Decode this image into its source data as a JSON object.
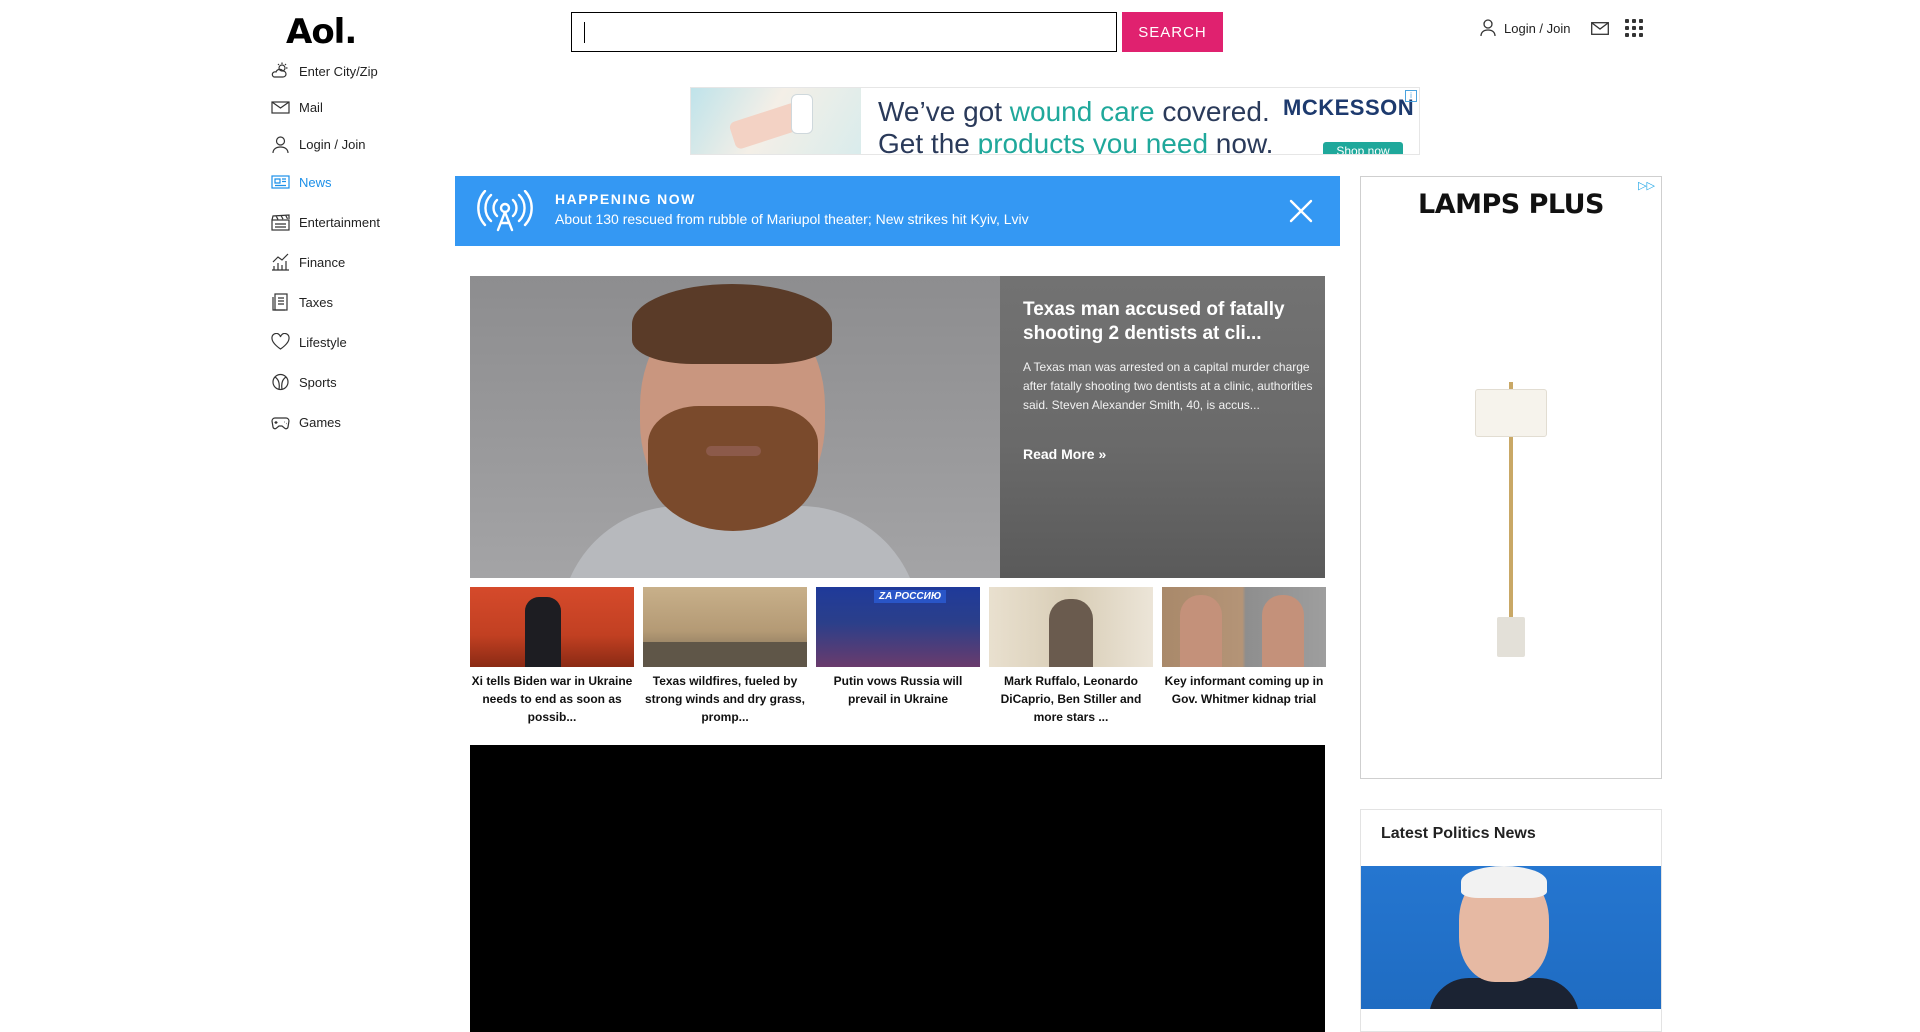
{
  "header": {
    "logo": "Aol.",
    "search": {
      "value": "",
      "button": "SEARCH"
    },
    "login": "Login / Join",
    "mail_icon": "mail-icon",
    "apps_icon": "apps-grid-icon"
  },
  "sidebar": {
    "items": [
      {
        "label": "Enter City/Zip",
        "icon": "weather-icon",
        "active": false
      },
      {
        "label": "Mail",
        "icon": "mail-icon",
        "active": false
      },
      {
        "label": "Login / Join",
        "icon": "user-icon",
        "active": false
      },
      {
        "label": "News",
        "icon": "news-icon",
        "active": true
      },
      {
        "label": "Entertainment",
        "icon": "clapperboard-icon",
        "active": false
      },
      {
        "label": "Finance",
        "icon": "finance-chart-icon",
        "active": false
      },
      {
        "label": "Taxes",
        "icon": "taxes-icon",
        "active": false
      },
      {
        "label": "Lifestyle",
        "icon": "heart-icon",
        "active": false
      },
      {
        "label": "Sports",
        "icon": "ball-icon",
        "active": false
      },
      {
        "label": "Games",
        "icon": "gamepad-icon",
        "active": false
      }
    ],
    "active_color": "#1b8fe8"
  },
  "ad_top": {
    "line1_pre": "We’ve got ",
    "line1_hl": "wound care",
    "line1_post": " covered.",
    "line2_pre": "Get the ",
    "line2_hl": "products you need",
    "line2_post": " now.",
    "brand": "MCKESSON",
    "cta": "Shop now"
  },
  "happening": {
    "label": "HAPPENING NOW",
    "text": "About 130 rescued from rubble of Mariupol theater; New strikes hit Kyiv, Lviv",
    "color": "#3498f3"
  },
  "hero": {
    "title": "Texas man accused of fatally shooting 2 dentists at cli...",
    "description": "A Texas man was arrested on a capital murder charge after fatally shooting two dentists at a clinic, authorities said. Steven Alexander Smith, 40, is accus...",
    "read_more": "Read More »"
  },
  "thumbnails": [
    {
      "caption": "Xi tells Biden war in Ukraine needs to end as soon as possib..."
    },
    {
      "caption": "Texas wildfires, fueled by strong winds and dry grass, promp..."
    },
    {
      "caption": "Putin vows Russia will prevail in Ukraine",
      "overlay": "ZA РОССИЮ"
    },
    {
      "caption": "Mark Ruffalo, Leonardo DiCaprio, Ben Stiller and more stars ..."
    },
    {
      "caption": "Key informant coming up in Gov. Whitmer kidnap trial"
    }
  ],
  "ad_right": {
    "brand": "LAMPS PLUS"
  },
  "latest": {
    "heading": "Latest Politics News"
  },
  "colors": {
    "search_button": "#e0216f",
    "happening_bg": "#3498f3",
    "news_active": "#1b8fe8"
  }
}
